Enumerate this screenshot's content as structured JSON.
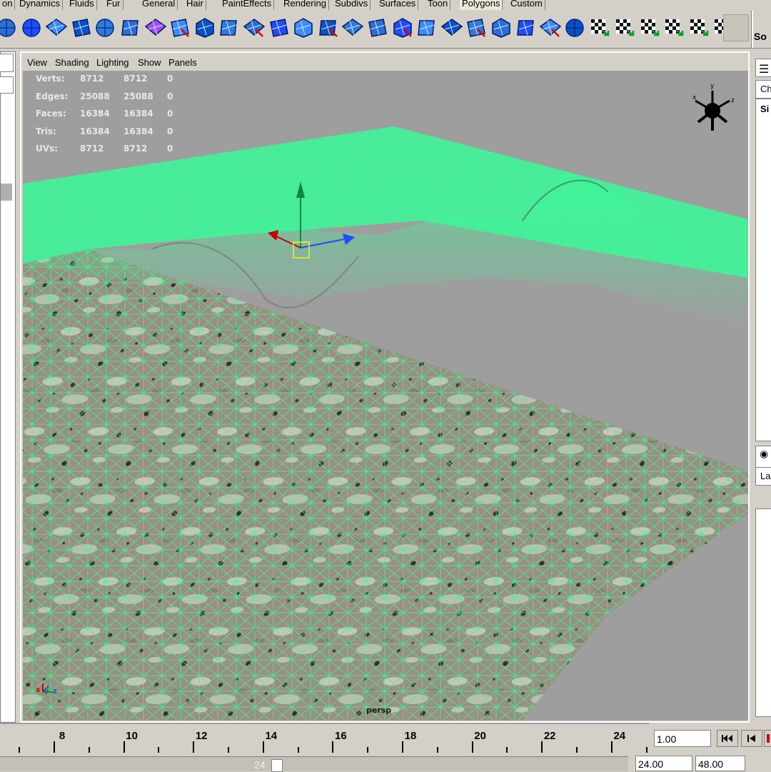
{
  "shelf": {
    "tabs": [
      {
        "label": "on",
        "active": false
      },
      {
        "label": "Dynamics",
        "active": false
      },
      {
        "label": "Fluids",
        "active": false
      },
      {
        "label": "Fur",
        "active": false
      },
      {
        "label": "General",
        "active": false
      },
      {
        "label": "Hair",
        "active": false
      },
      {
        "label": "PaintEffects",
        "active": false
      },
      {
        "label": "Rendering",
        "active": false
      },
      {
        "label": "Subdivs",
        "active": false
      },
      {
        "label": "Surfaces",
        "active": false
      },
      {
        "label": "Toon",
        "active": false
      },
      {
        "label": "Polygons",
        "active": true
      },
      {
        "label": "Custom",
        "active": false
      }
    ],
    "icons": [
      "sphere-partial-icon",
      "soccer-sphere-icon",
      "poly-plane-icon",
      "combine-icon",
      "poly-sphere-icon",
      "poly-cube-icon",
      "poly-cube-purple-icon",
      "extrude-face-icon",
      "split-polygon-icon",
      "extrude-edge-icon",
      "wedge-face-icon",
      "poly-bevel-icon",
      "merge-vertex-icon",
      "poly-cylinder-icon",
      "split-edge-icon",
      "poly-smooth-icon",
      "insert-edge-loop-icon",
      "poly-subdivide-icon",
      "chamfer-icon",
      "poly-append-icon",
      "poly-duplicate-icon",
      "poly-planar-map-icon",
      "uv-texture-editor-icon",
      "sphere-map-icon",
      "checker-map-icon",
      "checker-map-x-icon",
      "checker-sphere-icon",
      "checker-cube-icon",
      "checker-text-icon",
      "checker-cut-icon"
    ],
    "right_label": "So"
  },
  "panel_menu": {
    "items": [
      "View",
      "Shading",
      "Lighting",
      "Show",
      "Panels"
    ]
  },
  "hud": {
    "rows": [
      {
        "label": "Verts:",
        "a": "8712",
        "b": "8712",
        "c": "0"
      },
      {
        "label": "Edges:",
        "a": "25088",
        "b": "25088",
        "c": "0"
      },
      {
        "label": "Faces:",
        "a": "16384",
        "b": "16384",
        "c": "0"
      },
      {
        "label": "Tris:",
        "a": "16384",
        "b": "16384",
        "c": "0"
      },
      {
        "label": "UVs:",
        "a": "8712",
        "b": "8712",
        "c": "0"
      }
    ],
    "camera": "persp",
    "view_axes": {
      "x": "x",
      "y": "y",
      "z": "z"
    }
  },
  "right_panel": {
    "channel_box_tab": "Ch",
    "channel_item": "Si",
    "layer_label": "La"
  },
  "timeline": {
    "ticks": [
      8,
      10,
      12,
      14,
      16,
      18,
      20,
      22,
      24
    ],
    "current_frame": "1.00"
  },
  "range": {
    "handle_label": "24",
    "end_time": "24.00",
    "max_time": "48.00"
  },
  "colors": {
    "wireframe": "#3ff598",
    "viewport_bg": "#9e9e9e",
    "ui_bg": "#d4d0c8",
    "hud_text": "#e8e8e8"
  }
}
